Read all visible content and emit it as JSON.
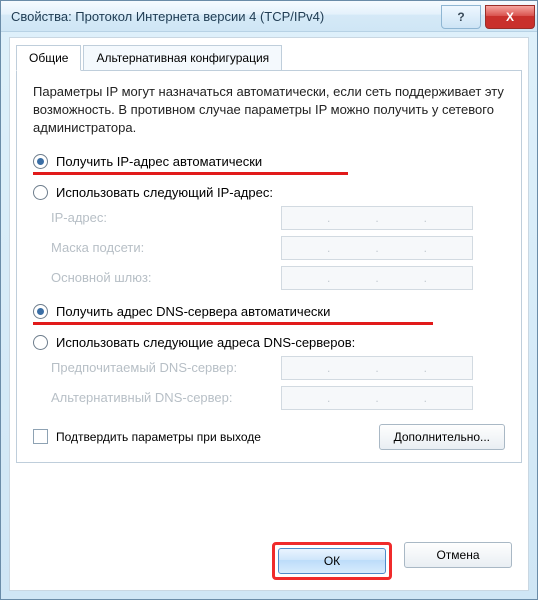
{
  "window": {
    "title": "Свойства: Протокол Интернета версии 4 (TCP/IPv4)",
    "help_glyph": "?",
    "close_glyph": "X"
  },
  "tabs": {
    "general": "Общие",
    "alt": "Альтернативная конфигурация"
  },
  "intro": "Параметры IP могут назначаться автоматически, если сеть поддерживает эту возможность. В противном случае параметры IP можно получить у сетевого администратора.",
  "ip": {
    "auto": "Получить IP-адрес автоматически",
    "manual": "Использовать следующий IP-адрес:",
    "fields": {
      "address": "IP-адрес:",
      "mask": "Маска подсети:",
      "gateway": "Основной шлюз:"
    }
  },
  "dns": {
    "auto": "Получить адрес DNS-сервера автоматически",
    "manual": "Использовать следующие адреса DNS-серверов:",
    "fields": {
      "preferred": "Предпочитаемый DNS-сервер:",
      "alternate": "Альтернативный DNS-сервер:"
    }
  },
  "confirm_exit": "Подтвердить параметры при выходе",
  "buttons": {
    "advanced": "Дополнительно...",
    "ok": "ОК",
    "cancel": "Отмена"
  },
  "dot": "."
}
